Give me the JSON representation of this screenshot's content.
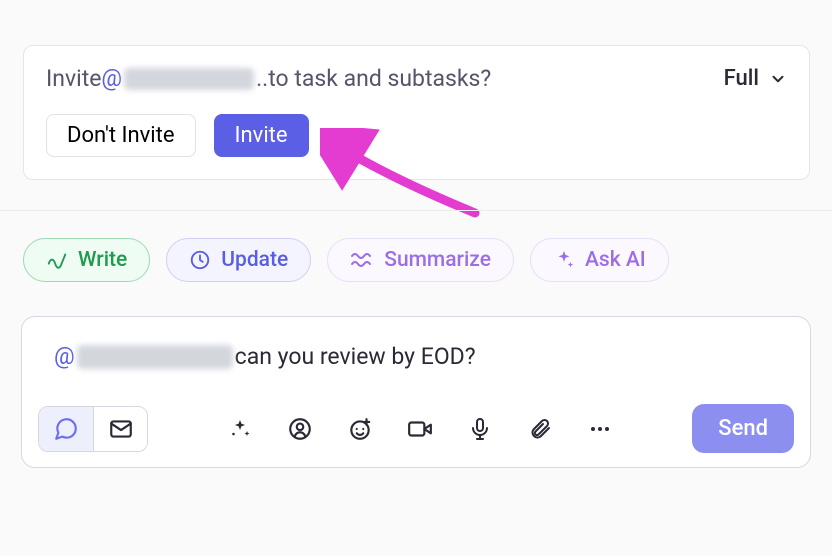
{
  "invite_prompt": {
    "prefix": "Invite ",
    "at": "@",
    "ellipsis": "..",
    "suffix": " to task and subtasks?",
    "scope_label": "Full",
    "dont_invite_label": "Don't Invite",
    "invite_label": "Invite"
  },
  "ai_actions": {
    "write": "Write",
    "update": "Update",
    "summarize": "Summarize",
    "ask": "Ask AI"
  },
  "composer": {
    "at": "@",
    "message_suffix": " can you review by EOD?",
    "send_label": "Send"
  },
  "colors": {
    "primary": "#5b5fe6",
    "green": "#1f9b4d",
    "purple": "#9c6ee6",
    "pointer": "#e43bd1"
  }
}
